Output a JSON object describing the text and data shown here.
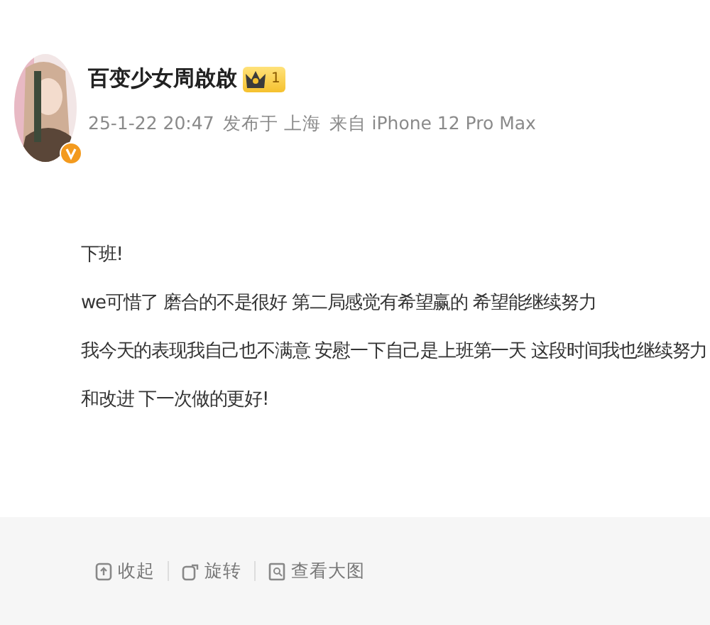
{
  "author": {
    "name": "百变少女周啟啟",
    "vip_level": "1",
    "verified": true
  },
  "meta": {
    "time": "25-1-22 20:47",
    "location": "发布于 上海",
    "source": "来自 iPhone 12 Pro Max"
  },
  "post_lines": [
    "下班!",
    "we可惜了 磨合的不是很好 第二局感觉有希望赢的 希望能继续努力",
    "我今天的表现我自己也不满意 安慰一下自己是上班第一天 这段时间我也继续努力",
    "和改进 下一次做的更好!"
  ],
  "image_actions": [
    {
      "kind": "collapse",
      "label": "收起"
    },
    {
      "kind": "rotate",
      "label": "旋转"
    },
    {
      "kind": "zoom",
      "label": "查看大图"
    }
  ]
}
